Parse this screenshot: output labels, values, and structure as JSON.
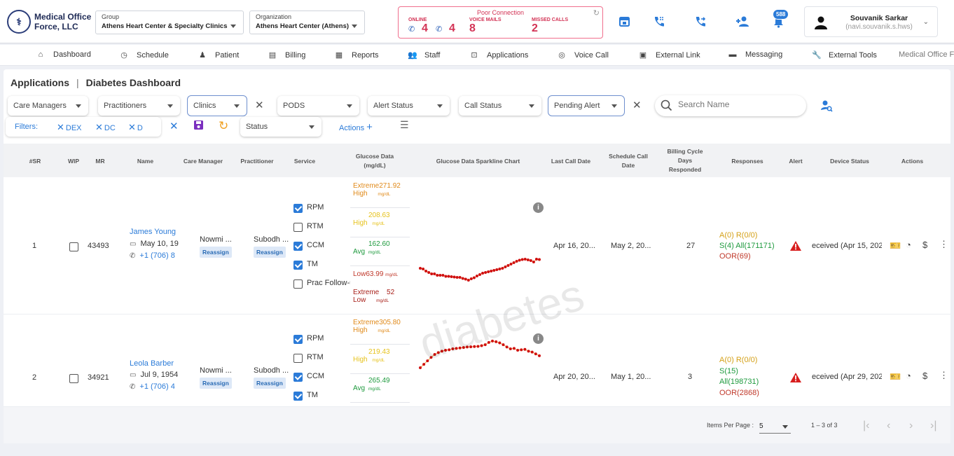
{
  "header": {
    "logo_line1": "Medical Office",
    "logo_line2": "Force, LLC",
    "group_label": "Group",
    "group_value": "Athens Heart Center & Specialty Clinics",
    "org_label": "Organization",
    "org_value": "Athens Heart Center (Athens)",
    "connection": {
      "title": "Poor Connection",
      "online_label": "ONLINE",
      "online_a": "4",
      "online_b": "4",
      "voicemail_label": "VOICE MAILS",
      "voicemail_count": "8",
      "missed_label": "MISSED CALLS",
      "missed_count": "2"
    },
    "notification_count": "588",
    "user_name": "Souvanik Sarkar",
    "user_id": "(navi.souvanik.s.hws)"
  },
  "nav": [
    {
      "label": "Dashboard",
      "icon": "home-icon",
      "glyph": "⌂"
    },
    {
      "label": "Schedule",
      "icon": "clock-icon",
      "glyph": "◷"
    },
    {
      "label": "Patient",
      "icon": "patient-icon",
      "glyph": "♟"
    },
    {
      "label": "Billing",
      "icon": "billing-icon",
      "glyph": "▤"
    },
    {
      "label": "Reports",
      "icon": "reports-icon",
      "glyph": "▦"
    },
    {
      "label": "Staff",
      "icon": "staff-icon",
      "glyph": "👥"
    },
    {
      "label": "Applications",
      "icon": "applications-icon",
      "glyph": "⊡"
    },
    {
      "label": "Voice Call",
      "icon": "voicemail-icon",
      "glyph": "◎"
    },
    {
      "label": "External Link",
      "icon": "external-link-icon",
      "glyph": "▣"
    },
    {
      "label": "Messaging",
      "icon": "messaging-icon",
      "glyph": "▬"
    },
    {
      "label": "External Tools",
      "icon": "wrench-icon",
      "glyph": "🔧"
    },
    {
      "label": "Medical Office Fo",
      "icon": "",
      "glyph": ""
    }
  ],
  "breadcrumb": {
    "root": "Applications",
    "sep": "|",
    "current": "Diabetes Dashboard"
  },
  "filters": {
    "care_managers": "Care Managers",
    "practitioners": "Practitioners",
    "clinics": "Clinics",
    "pods": "PODS",
    "alert_status": "Alert Status",
    "call_status": "Call Status",
    "pending_alert": "Pending Alert",
    "search_placeholder": "Search Name",
    "filters_label": "Filters:",
    "chips": [
      "DEX",
      "DC",
      "D"
    ],
    "status": "Status",
    "actions": "Actions"
  },
  "columns": {
    "sr": "#SR",
    "wip": "WIP",
    "mr": "MR",
    "name": "Name",
    "care_manager": "Care Manager",
    "practitioner": "Practitioner",
    "service": "Service",
    "glucose_1": "Glucose Data",
    "glucose_2": "(mg/dL)",
    "sparkline": "Glucose Data Sparkline Chart",
    "last_call": "Last Call Date",
    "schedule_1": "Schedule Call",
    "schedule_2": "Date",
    "billing_1": "Billing Cycle",
    "billing_2": "Days",
    "billing_3": "Responded",
    "responses": "Responses",
    "alert": "Alert",
    "device": "Device Status",
    "actions": "Actions"
  },
  "rows": [
    {
      "sr": "1",
      "mr": "43493",
      "name": "James Young",
      "dob": "May 10, 19",
      "phone": "+1 (706) 8",
      "care_manager": "Nowmi ...",
      "practitioner": "Subodh ...",
      "reassign": "Reassign",
      "services": [
        {
          "label": "RPM",
          "checked": true
        },
        {
          "label": "RTM",
          "checked": false
        },
        {
          "label": "CCM",
          "checked": true
        },
        {
          "label": "TM",
          "checked": true
        },
        {
          "label": "Prac Follow-u",
          "checked": false
        }
      ],
      "glucose": {
        "extreme_high_label": "Extreme",
        "extreme_high_label2": "High",
        "extreme_high": "271.92",
        "high_label": "High",
        "high": "208.63",
        "avg_label": "Avg",
        "avg": "162.60",
        "low_label": "Low",
        "low": "63.99",
        "extreme_low_label": "Extreme",
        "extreme_low_label2": "Low",
        "extreme_low": "52",
        "unit": "mg/dL"
      },
      "spark": [
        120,
        118,
        112,
        108,
        104,
        104,
        100,
        100,
        100,
        97,
        97,
        96,
        95,
        94,
        94,
        91,
        89,
        86,
        90,
        93,
        98,
        102,
        106,
        108,
        110,
        112,
        114,
        116,
        118,
        120,
        124,
        128,
        132,
        136,
        140,
        143,
        145,
        146,
        144,
        142,
        138,
        146,
        145
      ],
      "last_call": "Apr 16, 20...",
      "schedule_call": "May 2, 20...",
      "billing_days": "27",
      "responses": {
        "a": "A(0)",
        "r": "R(0/0)",
        "s": "S(4)",
        "all": "All(171171)",
        "oor": "OOR(69)"
      },
      "device_status": "eceived (Apr 15, 202"
    },
    {
      "sr": "2",
      "mr": "34921",
      "name": "Leola Barber",
      "dob": "Jul 9, 1954",
      "phone": "+1 (706) 4",
      "care_manager": "Nowmi ...",
      "practitioner": "Subodh ...",
      "reassign": "Reassign",
      "services": [
        {
          "label": "RPM",
          "checked": true
        },
        {
          "label": "RTM",
          "checked": false
        },
        {
          "label": "CCM",
          "checked": true
        },
        {
          "label": "TM",
          "checked": true
        }
      ],
      "glucose": {
        "extreme_high_label": "Extreme",
        "extreme_high_label2": "High",
        "extreme_high": "305.80",
        "high_label": "High",
        "high": "219.43",
        "avg_label": "Avg",
        "avg": "265.49",
        "unit": "mg/dL"
      },
      "spark": [
        180,
        195,
        210,
        225,
        238,
        246,
        252,
        256,
        258,
        262,
        264,
        266,
        268,
        270,
        271,
        272,
        273,
        276,
        280,
        290,
        296,
        293,
        288,
        280,
        270,
        262,
        264,
        256,
        258,
        260,
        252,
        248,
        240,
        232
      ],
      "last_call": "Apr 20, 20...",
      "schedule_call": "May 1, 20...",
      "billing_days": "3",
      "responses": {
        "a": "A(0)",
        "r": "R(0/0)",
        "s": "S(15)",
        "all": "All(198731)",
        "oor": "OOR(2868)"
      },
      "device_status": "eceived (Apr 29, 202"
    }
  ],
  "watermark": "diabetes",
  "pagination": {
    "items_label": "Items Per Page :",
    "page_size": "5",
    "range": "1 – 3 of 3"
  }
}
